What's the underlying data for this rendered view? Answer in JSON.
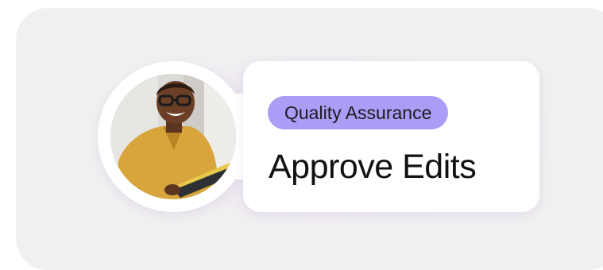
{
  "card": {
    "badge_label": "Quality Assurance",
    "title": "Approve Edits"
  },
  "colors": {
    "panel_background": "#f1f0f1",
    "card_background": "#ffffff",
    "badge_background": "#ab9cf6",
    "title_text": "#111111"
  },
  "avatar": {
    "description_name": "person-photo"
  }
}
